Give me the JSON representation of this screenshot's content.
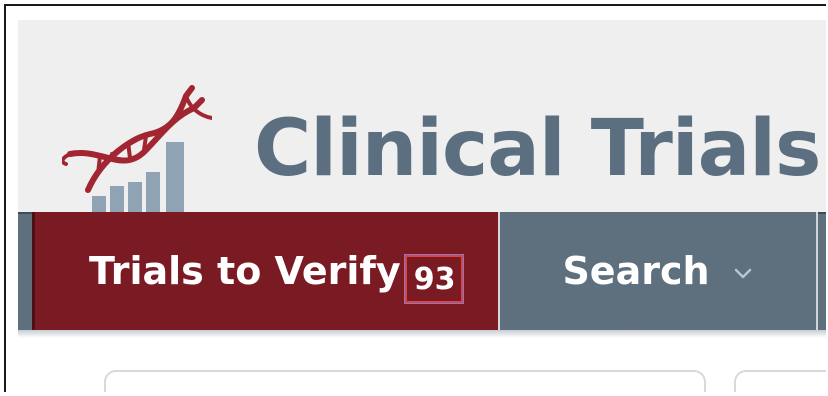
{
  "header": {
    "title": "Clinical Trials I",
    "logo_icon": "dna-chart-logo-icon"
  },
  "nav": {
    "tabs": [
      {
        "label": "Trials to Verify",
        "count": "93",
        "active": true
      },
      {
        "label": "Search",
        "has_dropdown": true,
        "dropdown_icon": "chevron-down-icon"
      }
    ]
  },
  "colors": {
    "header_bg": "#efefef",
    "title": "#5c6f80",
    "active_tab": "#7a1b24",
    "nav_bg": "#5e6f7e",
    "highlight_box": "#e0443c"
  }
}
